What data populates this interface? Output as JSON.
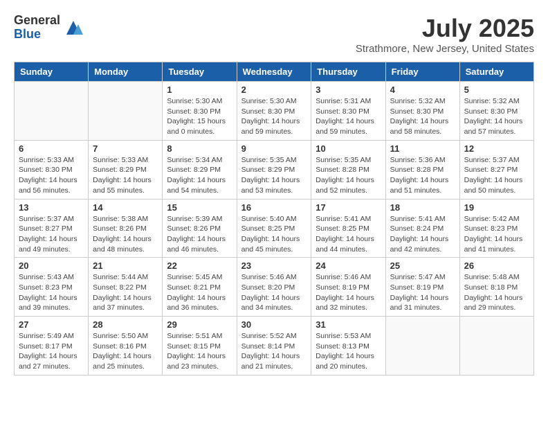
{
  "logo": {
    "general": "General",
    "blue": "Blue"
  },
  "title": "July 2025",
  "location": "Strathmore, New Jersey, United States",
  "weekdays": [
    "Sunday",
    "Monday",
    "Tuesday",
    "Wednesday",
    "Thursday",
    "Friday",
    "Saturday"
  ],
  "weeks": [
    [
      {
        "day": "",
        "info": ""
      },
      {
        "day": "",
        "info": ""
      },
      {
        "day": "1",
        "info": "Sunrise: 5:30 AM\nSunset: 8:30 PM\nDaylight: 15 hours\nand 0 minutes."
      },
      {
        "day": "2",
        "info": "Sunrise: 5:30 AM\nSunset: 8:30 PM\nDaylight: 14 hours\nand 59 minutes."
      },
      {
        "day": "3",
        "info": "Sunrise: 5:31 AM\nSunset: 8:30 PM\nDaylight: 14 hours\nand 59 minutes."
      },
      {
        "day": "4",
        "info": "Sunrise: 5:32 AM\nSunset: 8:30 PM\nDaylight: 14 hours\nand 58 minutes."
      },
      {
        "day": "5",
        "info": "Sunrise: 5:32 AM\nSunset: 8:30 PM\nDaylight: 14 hours\nand 57 minutes."
      }
    ],
    [
      {
        "day": "6",
        "info": "Sunrise: 5:33 AM\nSunset: 8:30 PM\nDaylight: 14 hours\nand 56 minutes."
      },
      {
        "day": "7",
        "info": "Sunrise: 5:33 AM\nSunset: 8:29 PM\nDaylight: 14 hours\nand 55 minutes."
      },
      {
        "day": "8",
        "info": "Sunrise: 5:34 AM\nSunset: 8:29 PM\nDaylight: 14 hours\nand 54 minutes."
      },
      {
        "day": "9",
        "info": "Sunrise: 5:35 AM\nSunset: 8:29 PM\nDaylight: 14 hours\nand 53 minutes."
      },
      {
        "day": "10",
        "info": "Sunrise: 5:35 AM\nSunset: 8:28 PM\nDaylight: 14 hours\nand 52 minutes."
      },
      {
        "day": "11",
        "info": "Sunrise: 5:36 AM\nSunset: 8:28 PM\nDaylight: 14 hours\nand 51 minutes."
      },
      {
        "day": "12",
        "info": "Sunrise: 5:37 AM\nSunset: 8:27 PM\nDaylight: 14 hours\nand 50 minutes."
      }
    ],
    [
      {
        "day": "13",
        "info": "Sunrise: 5:37 AM\nSunset: 8:27 PM\nDaylight: 14 hours\nand 49 minutes."
      },
      {
        "day": "14",
        "info": "Sunrise: 5:38 AM\nSunset: 8:26 PM\nDaylight: 14 hours\nand 48 minutes."
      },
      {
        "day": "15",
        "info": "Sunrise: 5:39 AM\nSunset: 8:26 PM\nDaylight: 14 hours\nand 46 minutes."
      },
      {
        "day": "16",
        "info": "Sunrise: 5:40 AM\nSunset: 8:25 PM\nDaylight: 14 hours\nand 45 minutes."
      },
      {
        "day": "17",
        "info": "Sunrise: 5:41 AM\nSunset: 8:25 PM\nDaylight: 14 hours\nand 44 minutes."
      },
      {
        "day": "18",
        "info": "Sunrise: 5:41 AM\nSunset: 8:24 PM\nDaylight: 14 hours\nand 42 minutes."
      },
      {
        "day": "19",
        "info": "Sunrise: 5:42 AM\nSunset: 8:23 PM\nDaylight: 14 hours\nand 41 minutes."
      }
    ],
    [
      {
        "day": "20",
        "info": "Sunrise: 5:43 AM\nSunset: 8:23 PM\nDaylight: 14 hours\nand 39 minutes."
      },
      {
        "day": "21",
        "info": "Sunrise: 5:44 AM\nSunset: 8:22 PM\nDaylight: 14 hours\nand 37 minutes."
      },
      {
        "day": "22",
        "info": "Sunrise: 5:45 AM\nSunset: 8:21 PM\nDaylight: 14 hours\nand 36 minutes."
      },
      {
        "day": "23",
        "info": "Sunrise: 5:46 AM\nSunset: 8:20 PM\nDaylight: 14 hours\nand 34 minutes."
      },
      {
        "day": "24",
        "info": "Sunrise: 5:46 AM\nSunset: 8:19 PM\nDaylight: 14 hours\nand 32 minutes."
      },
      {
        "day": "25",
        "info": "Sunrise: 5:47 AM\nSunset: 8:19 PM\nDaylight: 14 hours\nand 31 minutes."
      },
      {
        "day": "26",
        "info": "Sunrise: 5:48 AM\nSunset: 8:18 PM\nDaylight: 14 hours\nand 29 minutes."
      }
    ],
    [
      {
        "day": "27",
        "info": "Sunrise: 5:49 AM\nSunset: 8:17 PM\nDaylight: 14 hours\nand 27 minutes."
      },
      {
        "day": "28",
        "info": "Sunrise: 5:50 AM\nSunset: 8:16 PM\nDaylight: 14 hours\nand 25 minutes."
      },
      {
        "day": "29",
        "info": "Sunrise: 5:51 AM\nSunset: 8:15 PM\nDaylight: 14 hours\nand 23 minutes."
      },
      {
        "day": "30",
        "info": "Sunrise: 5:52 AM\nSunset: 8:14 PM\nDaylight: 14 hours\nand 21 minutes."
      },
      {
        "day": "31",
        "info": "Sunrise: 5:53 AM\nSunset: 8:13 PM\nDaylight: 14 hours\nand 20 minutes."
      },
      {
        "day": "",
        "info": ""
      },
      {
        "day": "",
        "info": ""
      }
    ]
  ]
}
